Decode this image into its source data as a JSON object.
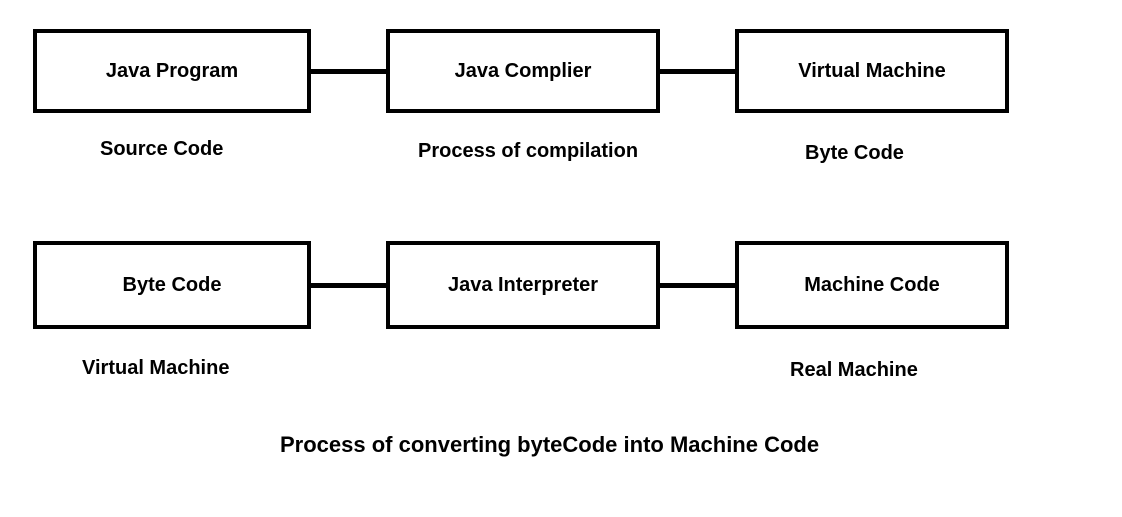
{
  "row1": {
    "box1": "Java Program",
    "box2": "Java Complier",
    "box3": "Virtual Machine",
    "sub1": "Source Code",
    "sub2": "Process of compilation",
    "sub3": "Byte Code"
  },
  "row2": {
    "box1": "Byte Code",
    "box2": "Java Interpreter",
    "box3": "Machine Code",
    "sub1": "Virtual Machine",
    "sub3": "Real Machine"
  },
  "caption": "Process of converting byteCode into Machine Code"
}
